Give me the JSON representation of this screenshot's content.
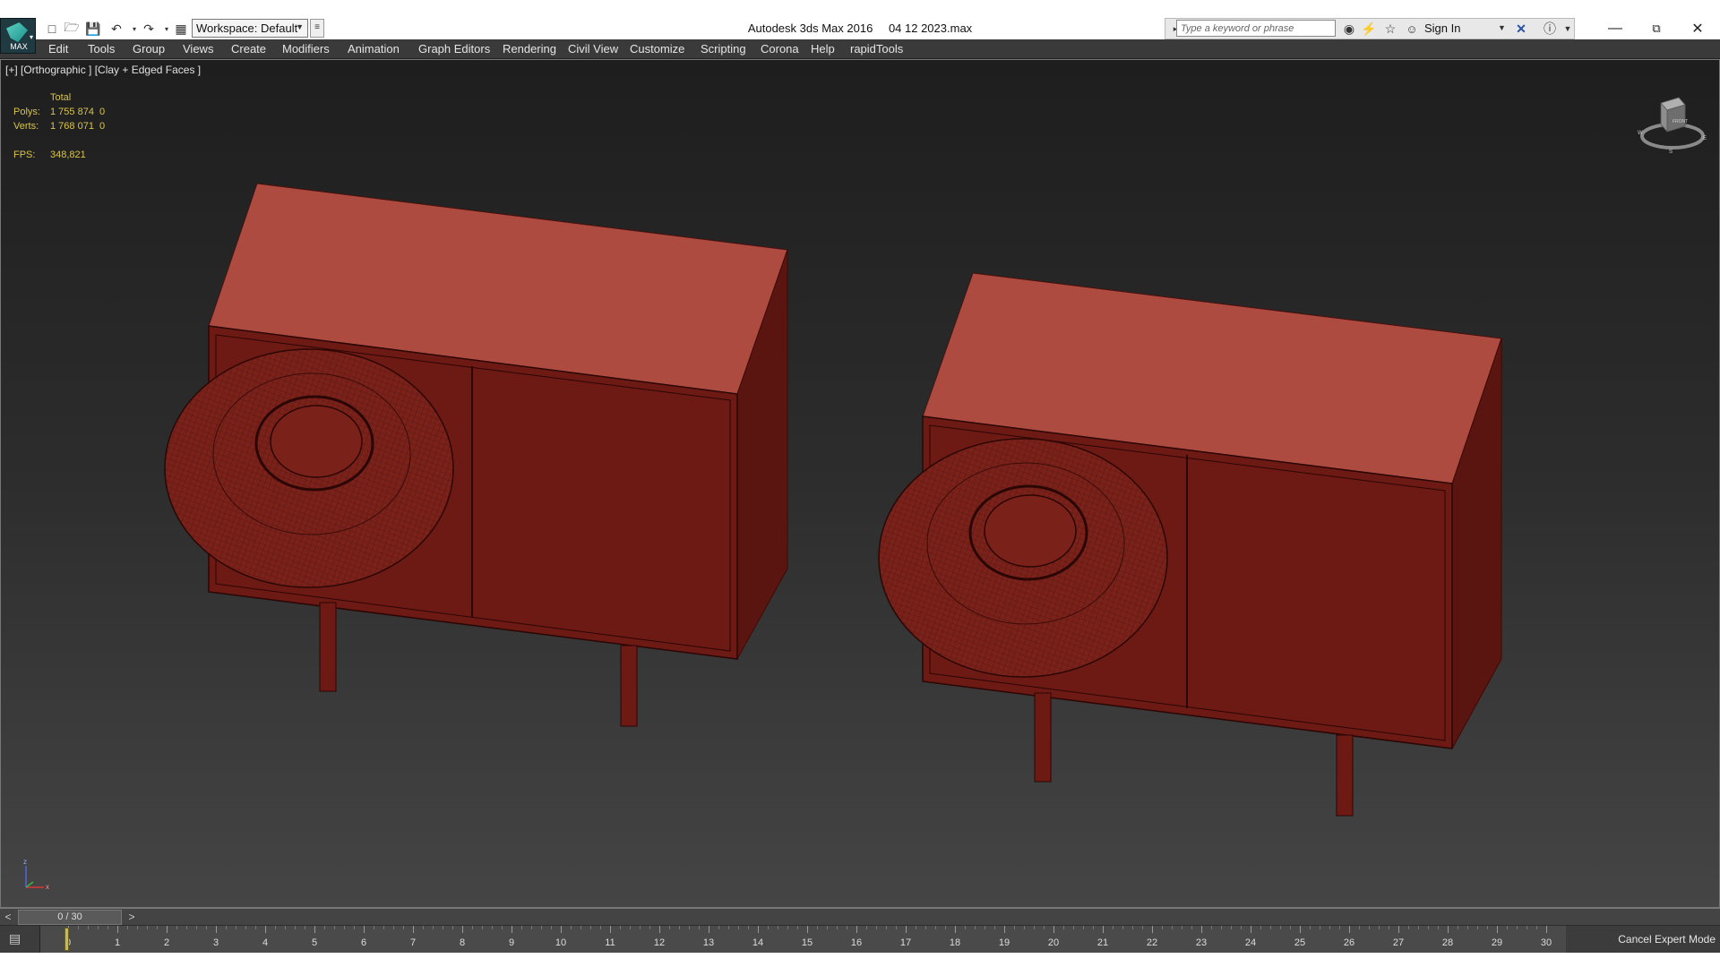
{
  "window": {
    "app_title": "Autodesk 3ds Max 2016",
    "file_name": "04 12 2023.max"
  },
  "app_logo": {
    "label": "MAX"
  },
  "quick_access": {
    "workspace_label": "Workspace: Default"
  },
  "infocenter": {
    "search_placeholder": "Type a keyword or phrase",
    "sign_in_label": "Sign In"
  },
  "menu": {
    "items": [
      "Edit",
      "Tools",
      "Group",
      "Views",
      "Create",
      "Modifiers",
      "Animation",
      "Graph Editors",
      "Rendering",
      "Civil View",
      "Customize",
      "Scripting",
      "Corona",
      "Help",
      "rapidTools"
    ]
  },
  "viewport": {
    "label": "[+] [Orthographic ] [Clay + Edged Faces ]",
    "stats": {
      "total_header": "Total",
      "polys_label": "Polys:",
      "polys_value": "1 755 874",
      "polys_sel": "0",
      "verts_label": "Verts:",
      "verts_value": "1 768 071",
      "verts_sel": "0",
      "fps_label": "FPS:",
      "fps_value": "348,821"
    },
    "object_color": "#a7463b",
    "object_dark": "#6e1a14",
    "object_mid": "#7a211a",
    "viewcube": {
      "face_label": "FRONT",
      "compass": [
        "S",
        "E",
        "W"
      ]
    },
    "axis": {
      "x": "x",
      "z": "z"
    }
  },
  "time_slider": {
    "frame_label": "0 / 30",
    "prev_label": "<",
    "next_label": ">"
  },
  "track_bar": {
    "ticks": [
      "0",
      "1",
      "2",
      "3",
      "4",
      "5",
      "6",
      "7",
      "8",
      "9",
      "10",
      "11",
      "12",
      "13",
      "14",
      "15",
      "16",
      "17",
      "18",
      "19",
      "20",
      "21",
      "22",
      "23",
      "24",
      "25",
      "26",
      "27",
      "28",
      "29",
      "30"
    ],
    "current_frame": 0
  },
  "status": {
    "cancel_expert_label": "Cancel Expert Mode"
  }
}
